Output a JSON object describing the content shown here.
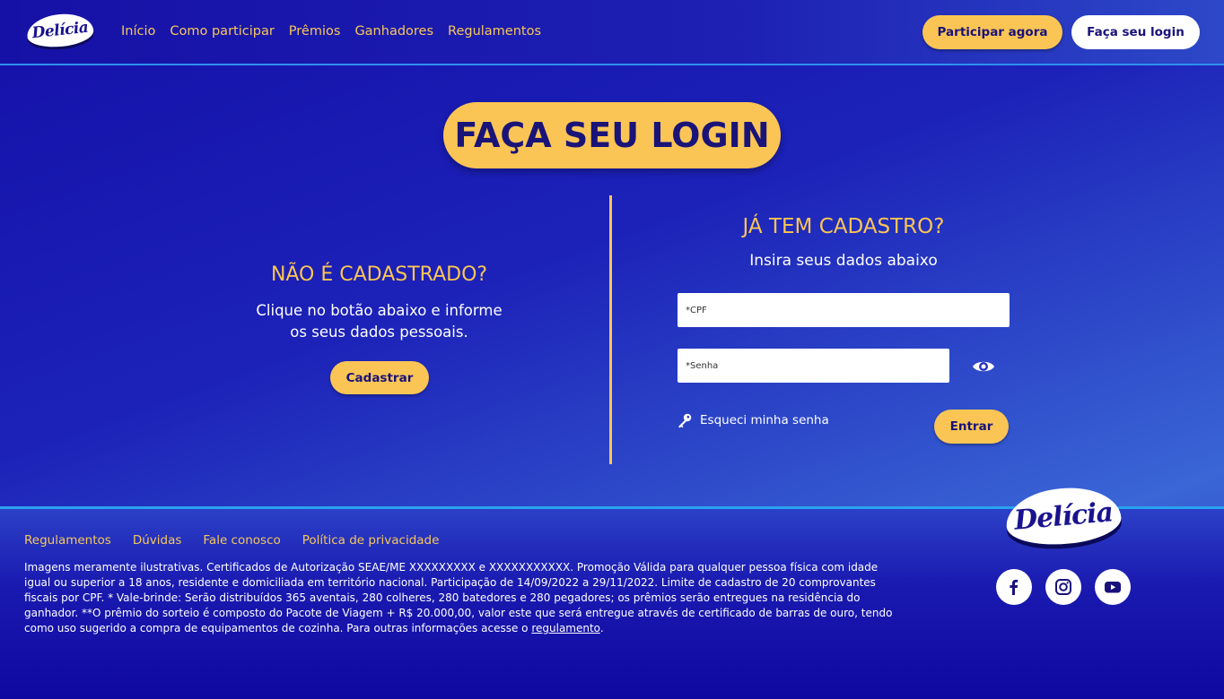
{
  "header": {
    "logo_text": "Delícia",
    "nav": [
      "Início",
      "Como participar",
      "Prêmios",
      "Ganhadores",
      "Regulamentos"
    ],
    "participar_label": "Participar agora",
    "login_label": "Faça seu login"
  },
  "main": {
    "title": "FAÇA SEU LOGIN",
    "left": {
      "heading": "NÃO É CADASTRADO?",
      "desc_line1": "Clique no botão abaixo e informe",
      "desc_line2": "os seus dados pessoais.",
      "button": "Cadastrar"
    },
    "right": {
      "heading": "JÁ TEM CADASTRO?",
      "subheading": "Insira seus dados abaixo",
      "cpf_placeholder": "*CPF",
      "senha_placeholder": "*Senha",
      "forgot_label": "Esqueci minha senha",
      "enter_button": "Entrar",
      "icons": [
        "eye-icon",
        "key-icon"
      ]
    }
  },
  "footer": {
    "links": [
      "Regulamentos",
      "Dúvidas",
      "Fale conosco",
      "Política de privacidade"
    ],
    "disclaimer": "Imagens meramente ilustrativas. Certificados de Autorização SEAE/ME XXXXXXXXX e XXXXXXXXXXX. Promoção Válida para qualquer pessoa física com idade igual ou superior a 18 anos, residente e domiciliada em território nacional. Participação de 14/09/2022 a 29/11/2022. Limite de cadastro de 20 comprovantes fiscais por CPF. * Vale-brinde: Serão distribuídos 365 aventais, 280 colheres, 280 batedores  e 280 pegadores; os prêmios serão entregues na residência do ganhador. **O prêmio do sorteio é composto do Pacote de Viagem + R$ 20.000,00, valor este que será entregue através de certificado de barras de ouro, tendo como uso sugerido a compra de equipamentos de cozinha. Para outras informações acesse o ",
    "disclaimer_link": "regulamento",
    "disclaimer_end": ".",
    "logo_text": "Delícia",
    "social": [
      "facebook-icon",
      "instagram-icon",
      "youtube-icon"
    ]
  },
  "colors": {
    "accent": "#fbc555",
    "navy": "#19127a",
    "background": "#1c22b8"
  }
}
